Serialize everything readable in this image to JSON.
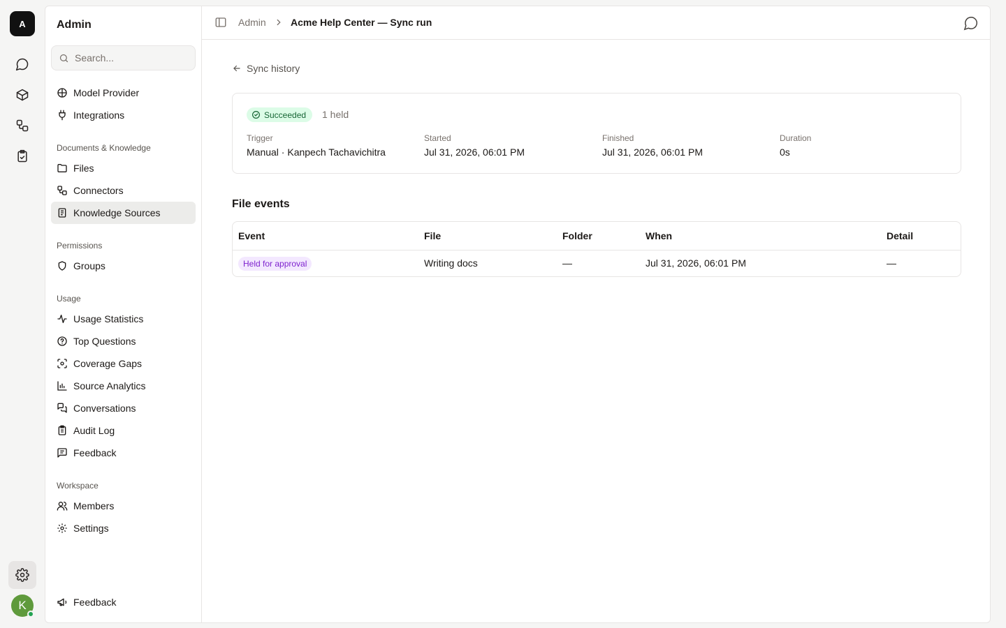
{
  "rail": {
    "logo_letter": "A",
    "avatar_letter": "K"
  },
  "sidebar": {
    "title": "Admin",
    "search_placeholder": "Search...",
    "top_items": [
      {
        "label": "Model Provider",
        "icon": "globe-icon"
      },
      {
        "label": "Integrations",
        "icon": "plug-icon"
      }
    ],
    "groups": [
      {
        "label": "Documents & Knowledge"
      },
      {
        "label": "Permissions"
      },
      {
        "label": "Usage"
      },
      {
        "label": "Workspace"
      }
    ],
    "docs_items": [
      {
        "label": "Files"
      },
      {
        "label": "Connectors"
      },
      {
        "label": "Knowledge Sources"
      }
    ],
    "perm_items": [
      {
        "label": "Groups"
      }
    ],
    "usage_items": [
      {
        "label": "Usage Statistics"
      },
      {
        "label": "Top Questions"
      },
      {
        "label": "Coverage Gaps"
      },
      {
        "label": "Source Analytics"
      },
      {
        "label": "Conversations"
      },
      {
        "label": "Audit Log"
      },
      {
        "label": "Feedback"
      }
    ],
    "workspace_items": [
      {
        "label": "Members"
      },
      {
        "label": "Settings"
      }
    ],
    "footer_item": {
      "label": "Feedback"
    },
    "active_item": "Knowledge Sources"
  },
  "topbar": {
    "breadcrumb_root": "Admin",
    "breadcrumb_current": "Acme Help Center — Sync run"
  },
  "back_link": "Sync history",
  "summary": {
    "status": "Succeeded",
    "held_count": "1 held",
    "trigger_label": "Trigger",
    "trigger_value": "Manual · Kanpech Tachavichitra",
    "started_label": "Started",
    "started_value": "Jul 31, 2026, 06:01 PM",
    "finished_label": "Finished",
    "finished_value": "Jul 31, 2026, 06:01 PM",
    "duration_label": "Duration",
    "duration_value": "0s"
  },
  "file_events": {
    "title": "File events",
    "columns": [
      "Event",
      "File",
      "Folder",
      "When",
      "Detail"
    ],
    "rows": [
      {
        "event": "Held for approval",
        "file": "Writing docs",
        "folder": "—",
        "when": "Jul 31, 2026, 06:01 PM",
        "detail": "—"
      }
    ]
  },
  "colors": {
    "success_bg": "#dcfce7",
    "success_text": "#166534",
    "held_bg": "#f3e8ff",
    "held_text": "#7e22ce",
    "avatar": "#5f9a3c"
  }
}
